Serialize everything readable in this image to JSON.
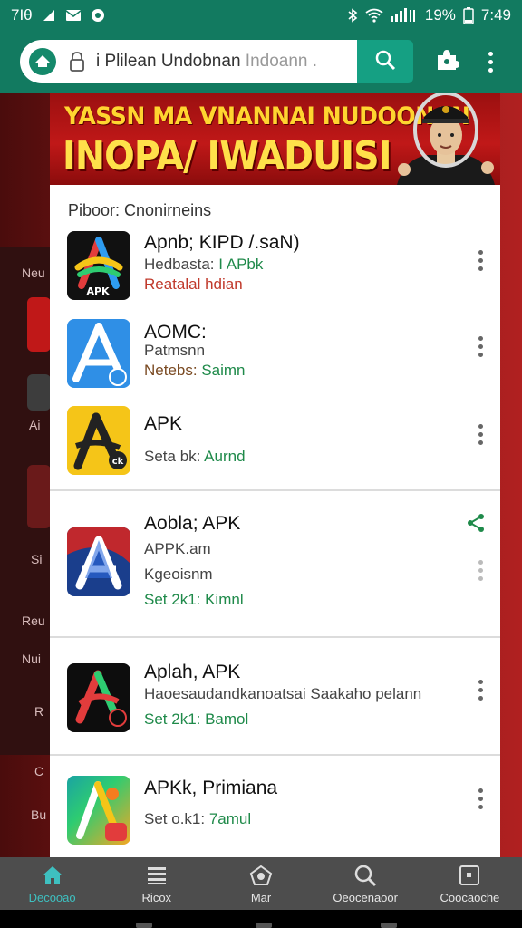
{
  "status_bar": {
    "left_text": "7Ιθ",
    "battery": "19%",
    "time": "7:49",
    "icons": [
      "signal-icon",
      "mail-icon",
      "circle-icon",
      "bluetooth-icon",
      "wifi-icon",
      "cell-signal-icon",
      "battery-icon"
    ]
  },
  "toolbar": {
    "url_main": "i Plilean Undobnan",
    "url_faded": "Indoann .",
    "icons": [
      "site-logo-icon",
      "lock-icon",
      "search-icon",
      "extension-icon",
      "menu-icon"
    ]
  },
  "banner": {
    "line1": "YASSN MA VNANNAI NUDOONAN",
    "line2": "INOPA/ IWADUISI"
  },
  "background_labels": [
    "Neu",
    "Ai",
    "Si",
    "Reu",
    "Nui",
    "R",
    "C",
    "Bu"
  ],
  "list": {
    "header": "Piboor: Cnonirneins",
    "items": [
      {
        "title": "Apnb; KIPD /.saN)",
        "lines": [
          {
            "text": "Hedbasta: ",
            "accent": "I APbk"
          },
          {
            "text": "Reatalal hdian"
          }
        ]
      },
      {
        "title": "AOMC:",
        "lines": [
          {
            "text": "Patmsnn"
          },
          {
            "text": "Netebs: ",
            "accent": "Saimn"
          }
        ]
      },
      {
        "title": "APK",
        "lines": [
          {
            "text": "Seta bk: ",
            "accent": "Aurnd"
          }
        ]
      },
      {
        "title": "Aobla; APK",
        "lines": [
          {
            "text": "APPK.am"
          },
          {
            "text": "Kgeoisnm"
          },
          {
            "text": "Set 2k1: Kimnl"
          }
        ]
      },
      {
        "title": "Aplah, APK",
        "lines": [
          {
            "text": "Haoesaudandkanoatsai Saakaho pelann"
          },
          {
            "text": "Set 2k1: Bamol"
          }
        ]
      },
      {
        "title": "APKk, Primiana",
        "lines": [
          {
            "text": "Set o.k1: ",
            "accent": "7amul"
          }
        ]
      }
    ],
    "icon_badges": [
      "APK",
      "ck"
    ]
  },
  "bottom_nav": [
    {
      "label": "Decooao",
      "icon": "home-icon"
    },
    {
      "label": "Ricox",
      "icon": "list-icon"
    },
    {
      "label": "Mar",
      "icon": "store-icon"
    },
    {
      "label": "Oeocenaoor",
      "icon": "search-icon"
    },
    {
      "label": "Coocaoche",
      "icon": "window-icon"
    }
  ],
  "colors": {
    "toolbar": "#127a60",
    "accent_green": "#1f8a4a",
    "nav_active": "#3ec0c0",
    "banner_red": "#c01818",
    "banner_text": "#ffe04a"
  }
}
